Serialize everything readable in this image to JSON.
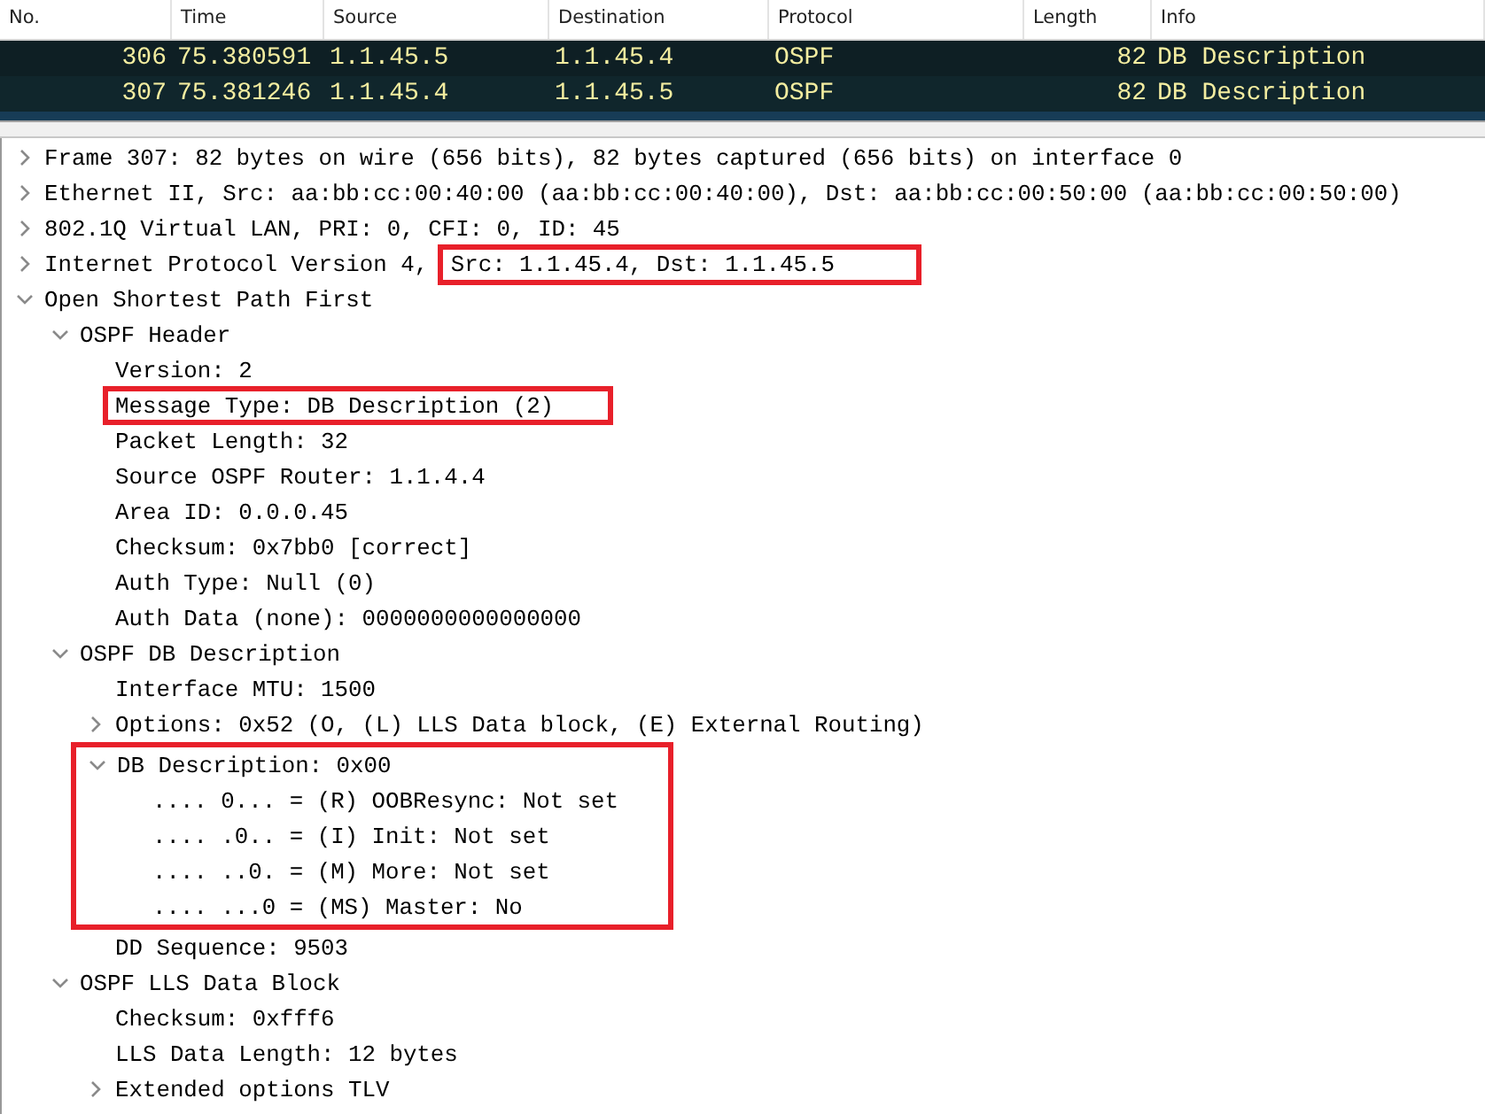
{
  "packet_list": {
    "columns": [
      "No.",
      "Time",
      "Source",
      "Destination",
      "Protocol",
      "Length",
      "Info"
    ],
    "rows": [
      {
        "cells": [
          "306",
          "75.380591",
          "1.1.45.5",
          "1.1.45.4",
          "OSPF",
          "82",
          "DB Description"
        ],
        "selected": true
      },
      {
        "cells": [
          "307",
          "75.381246",
          "1.1.45.4",
          "1.1.45.5",
          "OSPF",
          "82",
          "DB Description"
        ],
        "selected": true
      }
    ]
  },
  "details": [
    {
      "label": "Frame 307: 82 bytes on wire (656 bits), 82 bytes captured (656 bits) on interface 0",
      "expanded": false
    },
    {
      "label": "Ethernet II, Src: aa:bb:cc:00:40:00 (aa:bb:cc:00:40:00), Dst: aa:bb:cc:00:50:00 (aa:bb:cc:00:50:00)",
      "expanded": false
    },
    {
      "label": "802.1Q Virtual LAN, PRI: 0, CFI: 0, ID: 45",
      "expanded": false
    },
    {
      "label": "Internet Protocol Version 4,",
      "highlighted_part": "Src: 1.1.45.4, Dst: 1.1.45.5",
      "expanded": false
    },
    {
      "label": "Open Shortest Path First",
      "expanded": true,
      "children": [
        {
          "label": "OSPF Header",
          "expanded": true,
          "children": [
            {
              "label": "Version: 2"
            },
            {
              "label": "Message Type: DB Description (2)",
              "highlighted": true
            },
            {
              "label": "Packet Length: 32"
            },
            {
              "label": "Source OSPF Router: 1.1.4.4"
            },
            {
              "label": "Area ID: 0.0.0.45"
            },
            {
              "label": "Checksum: 0x7bb0 [correct]"
            },
            {
              "label": "Auth Type: Null (0)"
            },
            {
              "label": "Auth Data (none): 0000000000000000"
            }
          ]
        },
        {
          "label": "OSPF DB Description",
          "expanded": true,
          "children": [
            {
              "label": "Interface MTU: 1500"
            },
            {
              "label": "Options: 0x52 (O, (L) LLS Data block, (E) External Routing)",
              "expanded": false
            },
            {
              "label": "DB Description: 0x00",
              "expanded": true,
              "highlighted": true,
              "children": [
                {
                  "label": ".... 0... = (R) OOBResync: Not set"
                },
                {
                  "label": ".... .0.. = (I) Init: Not set"
                },
                {
                  "label": ".... ..0. = (M) More: Not set"
                },
                {
                  "label": ".... ...0 = (MS) Master: No"
                }
              ]
            },
            {
              "label": "DD Sequence: 9503"
            }
          ]
        },
        {
          "label": "OSPF LLS Data Block",
          "expanded": true,
          "children": [
            {
              "label": "Checksum: 0xfff6"
            },
            {
              "label": "LLS Data Length: 12 bytes"
            },
            {
              "label": "Extended options TLV",
              "expanded": false
            }
          ]
        }
      ]
    }
  ]
}
